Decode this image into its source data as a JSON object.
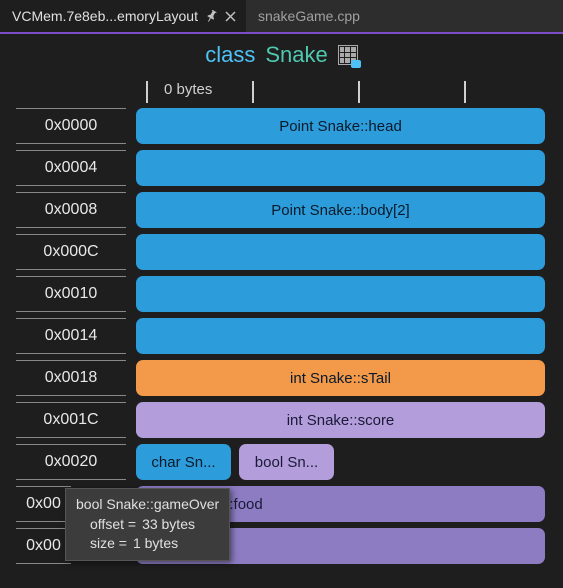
{
  "tabs": {
    "active": "VCMem.7e8eb...emoryLayout",
    "inactive": "snakeGame.cpp"
  },
  "header": {
    "keyword": "class",
    "className": "Snake"
  },
  "ruler": {
    "label": "0 bytes"
  },
  "offsets": [
    "0x0000",
    "0x0004",
    "0x0008",
    "0x000C",
    "0x0010",
    "0x0014",
    "0x0018",
    "0x001C",
    "0x0020",
    "0x00",
    "0x00"
  ],
  "members": {
    "head": "Point Snake::head",
    "body": "Point Snake::body[2]",
    "stail": "int Snake::sTail",
    "score": "int Snake::score",
    "charSn": "char Sn...",
    "boolSn": "bool Sn...",
    "food": "nt Snake::food"
  },
  "tooltip": {
    "title": "bool Snake::gameOver",
    "offsetLabel": "offset =",
    "offsetValue": "33 bytes",
    "sizeLabel": "size =",
    "sizeValue": "1 bytes"
  }
}
